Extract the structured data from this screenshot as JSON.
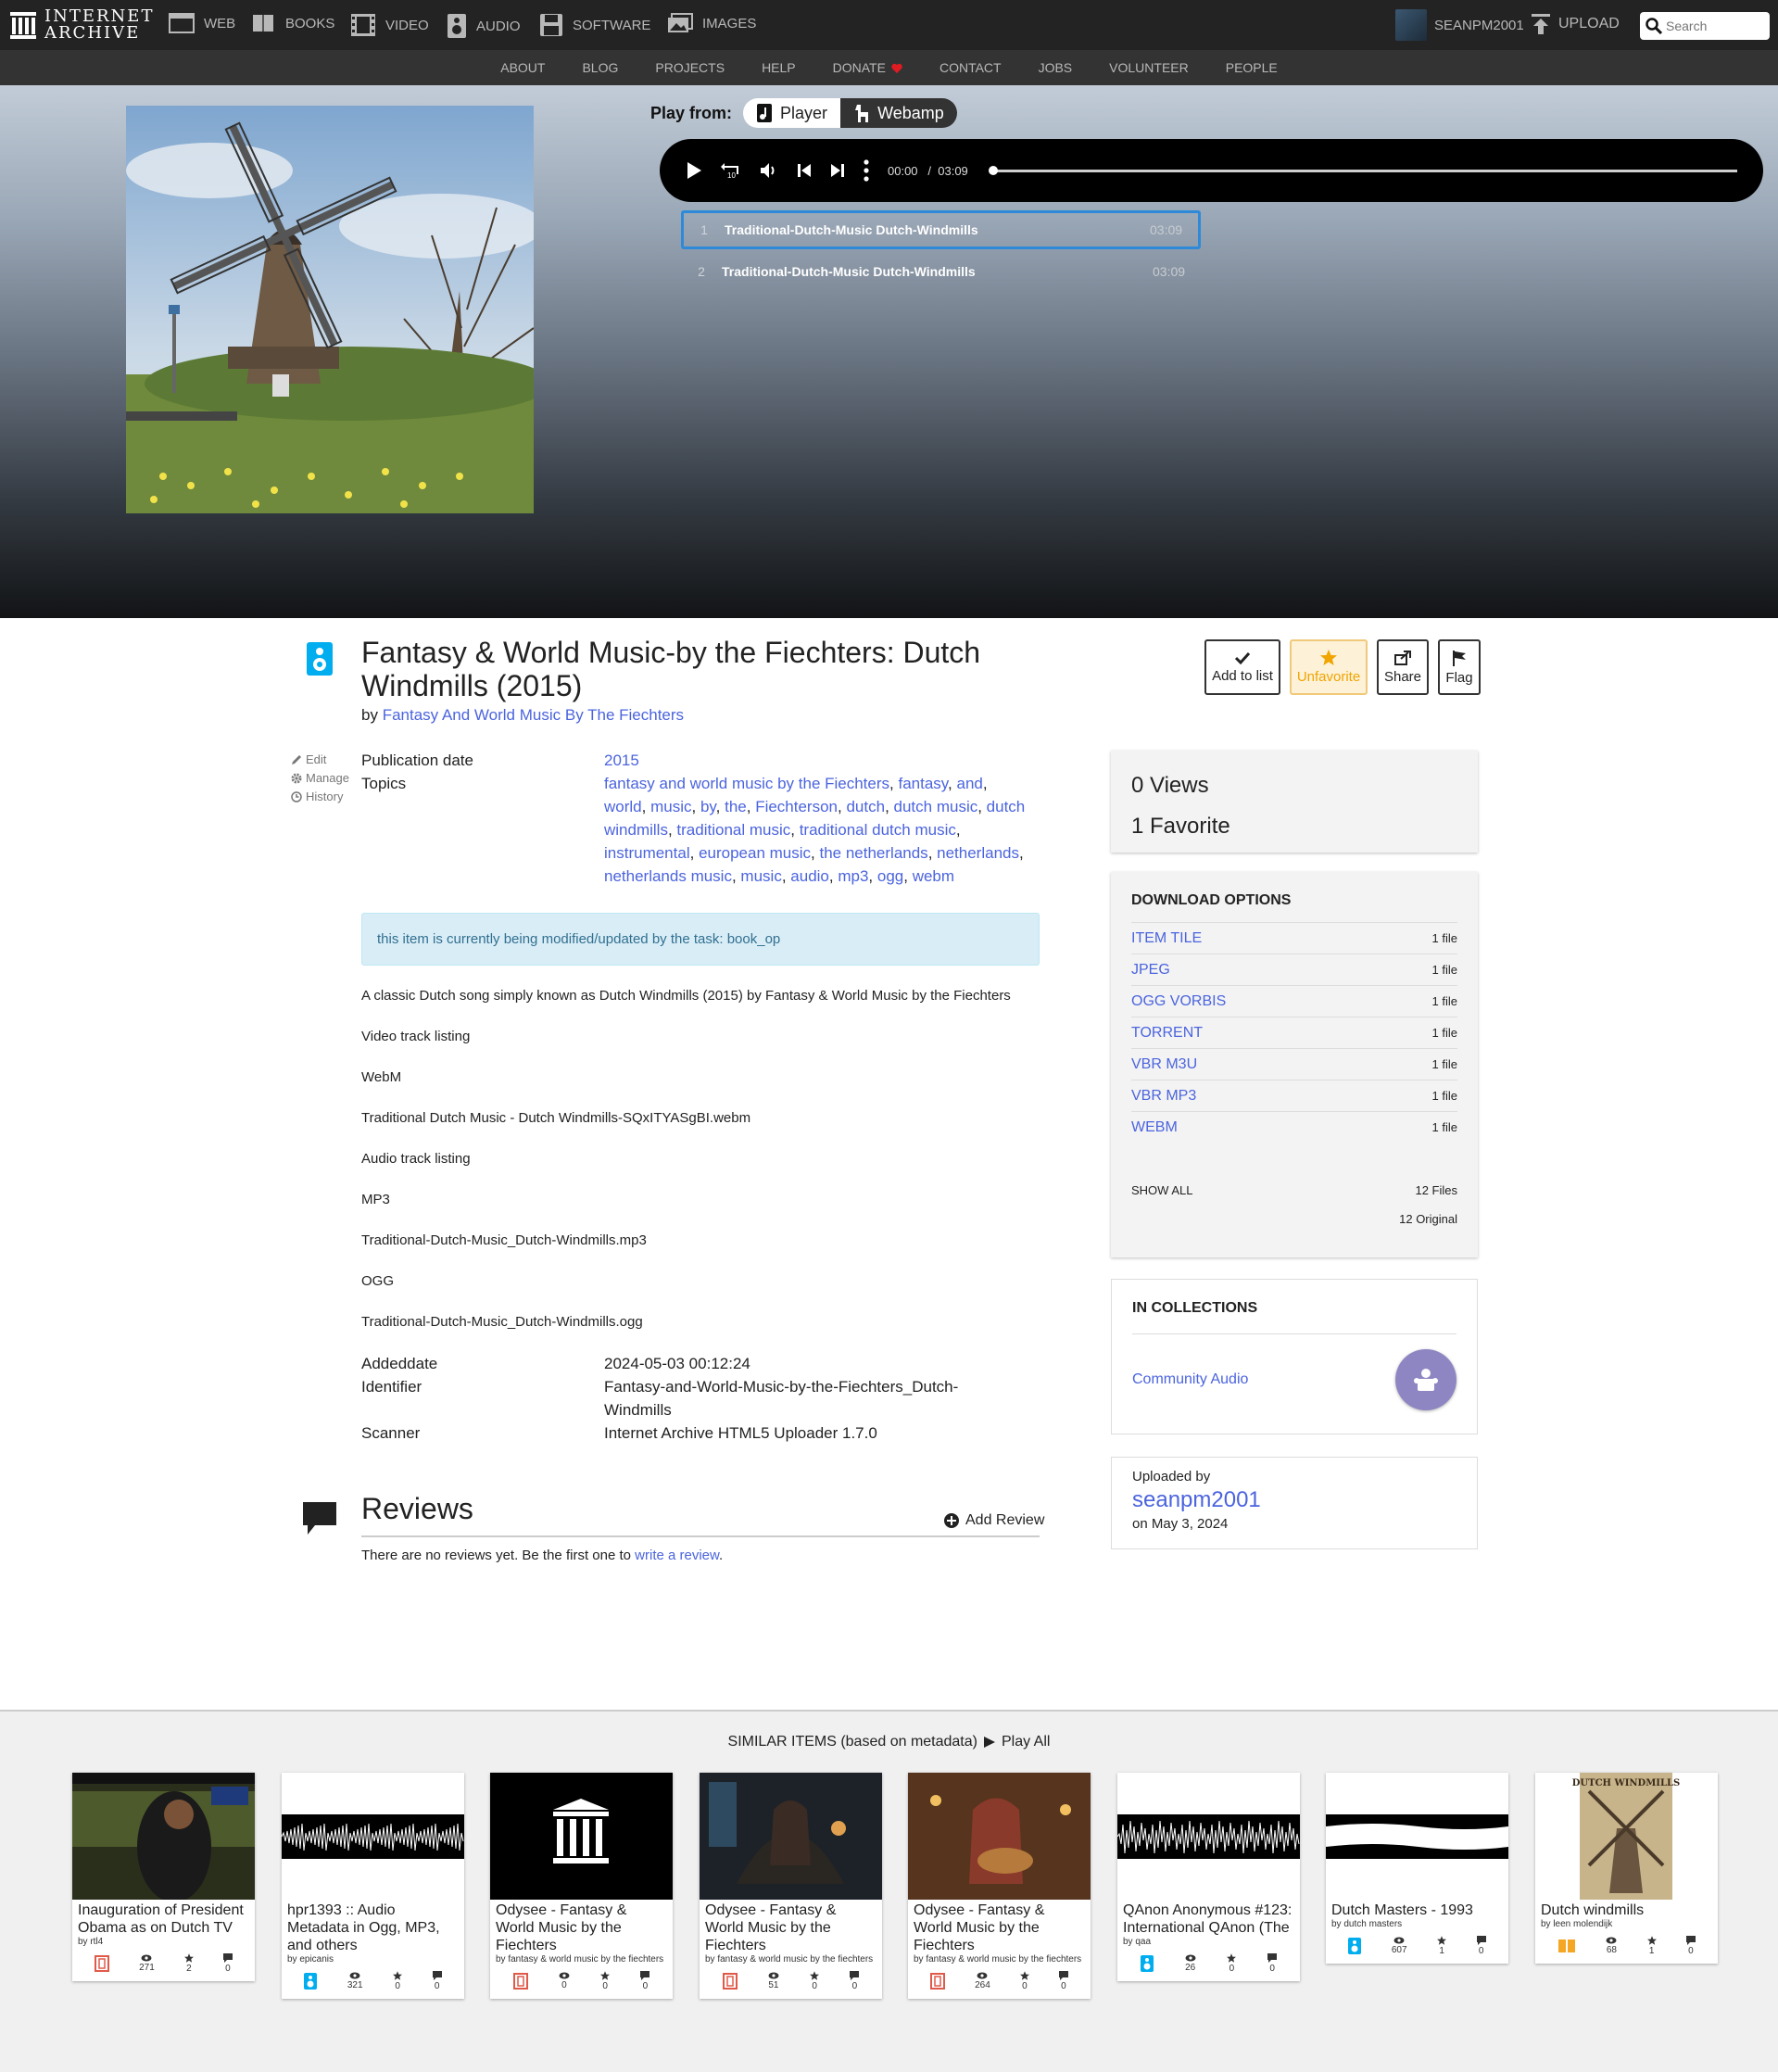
{
  "topnav": {
    "logo_line1": "INTERNET",
    "logo_line2": "ARCHIVE",
    "tabs": [
      {
        "label": "WEB",
        "icon": "web-icon"
      },
      {
        "label": "BOOKS",
        "icon": "books-icon"
      },
      {
        "label": "VIDEO",
        "icon": "video-icon"
      },
      {
        "label": "AUDIO",
        "icon": "audio-icon"
      },
      {
        "label": "SOFTWARE",
        "icon": "software-icon"
      },
      {
        "label": "IMAGES",
        "icon": "images-icon"
      }
    ],
    "username": "SEANPM2001",
    "upload_label": "UPLOAD",
    "search_placeholder": "Search"
  },
  "subnav": [
    "ABOUT",
    "BLOG",
    "PROJECTS",
    "HELP",
    "DONATE",
    "CONTACT",
    "JOBS",
    "VOLUNTEER",
    "PEOPLE"
  ],
  "player": {
    "play_from_label": "Play from:",
    "option_player": "Player",
    "option_webamp": "Webamp",
    "current_time": "00:00",
    "separator": "/",
    "duration": "03:09",
    "progress": 0,
    "tracks": [
      {
        "num": "1",
        "title": "Traditional-Dutch-Music Dutch-Windmills",
        "duration": "03:09"
      },
      {
        "num": "2",
        "title": "Traditional-Dutch-Music Dutch-Windmills",
        "duration": "03:09"
      }
    ]
  },
  "item": {
    "title": "Fantasy & World Music-by the Fiechters: Dutch Windmills (2015)",
    "by_prefix": "by",
    "creator": "Fantasy And World Music By The Fiechters",
    "actions": {
      "add_to_list": "Add to list",
      "unfavorite": "Unfavorite",
      "share": "Share",
      "flag": "Flag"
    },
    "edit_links": {
      "edit": "Edit",
      "manage": "Manage",
      "history": "History"
    },
    "publication_date_label": "Publication date",
    "publication_date": "2015",
    "topics_label": "Topics",
    "topics": [
      "fantasy and world music by the Fiechters",
      "fantasy",
      "and",
      "world",
      "music",
      "by",
      "the",
      "Fiechterson",
      "dutch",
      "dutch music",
      "dutch windmills",
      "traditional music",
      "traditional dutch music",
      "instrumental",
      "european music",
      "the netherlands",
      "netherlands",
      "netherlands music",
      "music",
      "audio",
      "mp3",
      "ogg",
      "webm"
    ],
    "notice": "this item is currently being modified/updated by the task: book_op",
    "description_lines": [
      "A classic Dutch song simply known as Dutch Windmills (2015) by Fantasy & World Music by the Fiechters",
      "Video track listing",
      "WebM",
      "Traditional Dutch Music - Dutch Windmills-SQxITYASgBI.webm",
      "Audio track listing",
      "MP3",
      "Traditional-Dutch-Music_Dutch-Windmills.mp3",
      "OGG",
      "Traditional-Dutch-Music_Dutch-Windmills.ogg"
    ],
    "addeddate_label": "Addeddate",
    "addeddate": "2024-05-03 00:12:24",
    "identifier_label": "Identifier",
    "identifier": "Fantasy-and-World-Music-by-the-Fiechters_Dutch-Windmills",
    "scanner_label": "Scanner",
    "scanner": "Internet Archive HTML5 Uploader 1.7.0"
  },
  "reviews": {
    "title": "Reviews",
    "add_label": "Add Review",
    "empty_prefix": "There are no reviews yet. Be the first one to",
    "empty_link": "write a review",
    "empty_suffix": "."
  },
  "sidebar": {
    "views": "0 Views",
    "favorites": "1 Favorite",
    "download_title": "DOWNLOAD OPTIONS",
    "downloads": [
      {
        "label": "ITEM TILE",
        "count": "1 file"
      },
      {
        "label": "JPEG",
        "count": "1 file"
      },
      {
        "label": "OGG VORBIS",
        "count": "1 file"
      },
      {
        "label": "TORRENT",
        "count": "1 file"
      },
      {
        "label": "VBR M3U",
        "count": "1 file"
      },
      {
        "label": "VBR MP3",
        "count": "1 file"
      },
      {
        "label": "WEBM",
        "count": "1 file"
      }
    ],
    "show_all": "SHOW ALL",
    "files_count": "12 Files",
    "original_count": "12 Original",
    "collections_title": "IN COLLECTIONS",
    "collection": "Community Audio",
    "uploaded_by_label": "Uploaded by",
    "uploader": "seanpm2001",
    "upload_date": "on May 3, 2024"
  },
  "similar": {
    "heading": "SIMILAR ITEMS (based on metadata)",
    "play_all": "Play All",
    "items": [
      {
        "title": "Inauguration of President Obama as on Dutch TV",
        "by": "by rtl4",
        "type": "film-icon",
        "views": "271",
        "favs": "2",
        "reviews": "0"
      },
      {
        "title": "hpr1393 :: Audio Metadata in Ogg, MP3, and others",
        "by": "by epicanis",
        "type": "audio-icon",
        "views": "321",
        "favs": "0",
        "reviews": "0"
      },
      {
        "title": "Odysee - Fantasy & World Music by the Fiechters",
        "by": "by fantasy & world music by the fiechters",
        "type": "film-icon",
        "views": "0",
        "favs": "0",
        "reviews": "0"
      },
      {
        "title": "Odysee - Fantasy & World Music by the Fiechters",
        "by": "by fantasy & world music by the fiechters",
        "type": "film-icon",
        "views": "51",
        "favs": "0",
        "reviews": "0"
      },
      {
        "title": "Odysee - Fantasy & World Music by the Fiechters",
        "by": "by fantasy & world music by the fiechters",
        "type": "film-icon",
        "views": "264",
        "favs": "0",
        "reviews": "0"
      },
      {
        "title": "QAnon Anonymous #123: International QAnon (The",
        "by": "by qaa",
        "type": "audio-icon",
        "views": "26",
        "favs": "0",
        "reviews": "0"
      },
      {
        "title": "Dutch Masters - 1993",
        "by": "by dutch masters",
        "type": "audio-icon",
        "views": "607",
        "favs": "1",
        "reviews": "0"
      },
      {
        "title": "Dutch windmills",
        "by": "by leen molendijk",
        "type": "book-icon",
        "views": "68",
        "favs": "1",
        "reviews": "0",
        "thumb_text": "DUTCH WINDMILLS"
      }
    ]
  }
}
